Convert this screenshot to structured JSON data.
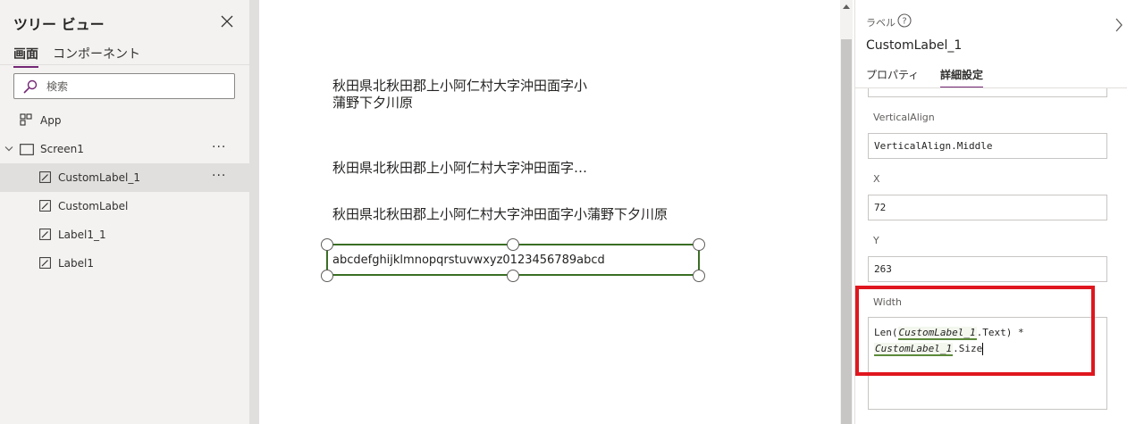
{
  "tree_view": {
    "title": "ツリー ビュー",
    "tabs": [
      {
        "label": "画面",
        "active": true
      },
      {
        "label": "コンポーネント",
        "active": false
      }
    ],
    "search": {
      "placeholder": "検索",
      "value": ""
    },
    "items": [
      {
        "label": "App",
        "icon": "app-icon"
      },
      {
        "label": "Screen1",
        "icon": "screen-icon",
        "expanded": true
      },
      {
        "label": "CustomLabel_1",
        "icon": "label-edit-icon",
        "selected": true
      },
      {
        "label": "CustomLabel",
        "icon": "label-edit-icon"
      },
      {
        "label": "Label1_1",
        "icon": "label-edit-icon"
      },
      {
        "label": "Label1",
        "icon": "label-edit-icon"
      }
    ],
    "more_glyph": "···"
  },
  "canvas": {
    "label_wrapped": "秋田県北秋田郡上小阿仁村大字沖田面字小蒲野下夕川原",
    "label_ellipsis": "秋田県北秋田郡上小阿仁村大字沖田面字小蒲野下夕川原",
    "label_full": "秋田県北秋田郡上小阿仁村大字沖田面字小蒲野下夕川原",
    "selected_label_text": "abcdefghijklmnopqrstuvwxyz0123456789abcd"
  },
  "properties": {
    "control_type": "ラベル",
    "control_name": "CustomLabel_1",
    "tabs": [
      {
        "label": "プロパティ",
        "active": false
      },
      {
        "label": "詳細設定",
        "active": true
      }
    ],
    "fields": [
      {
        "name": "VerticalAlign",
        "value": "VerticalAlign.Middle"
      },
      {
        "name": "X",
        "value": "72"
      },
      {
        "name": "Y",
        "value": "263"
      }
    ],
    "width": {
      "name": "Width",
      "formula_parts": [
        "Len(",
        "CustomLabel_1",
        ".Text) *",
        "CustomLabel_1",
        ".Size"
      ]
    }
  },
  "colors": {
    "accent": "#742774",
    "selection_border": "#3a6f25",
    "highlight": "#e0161e"
  }
}
